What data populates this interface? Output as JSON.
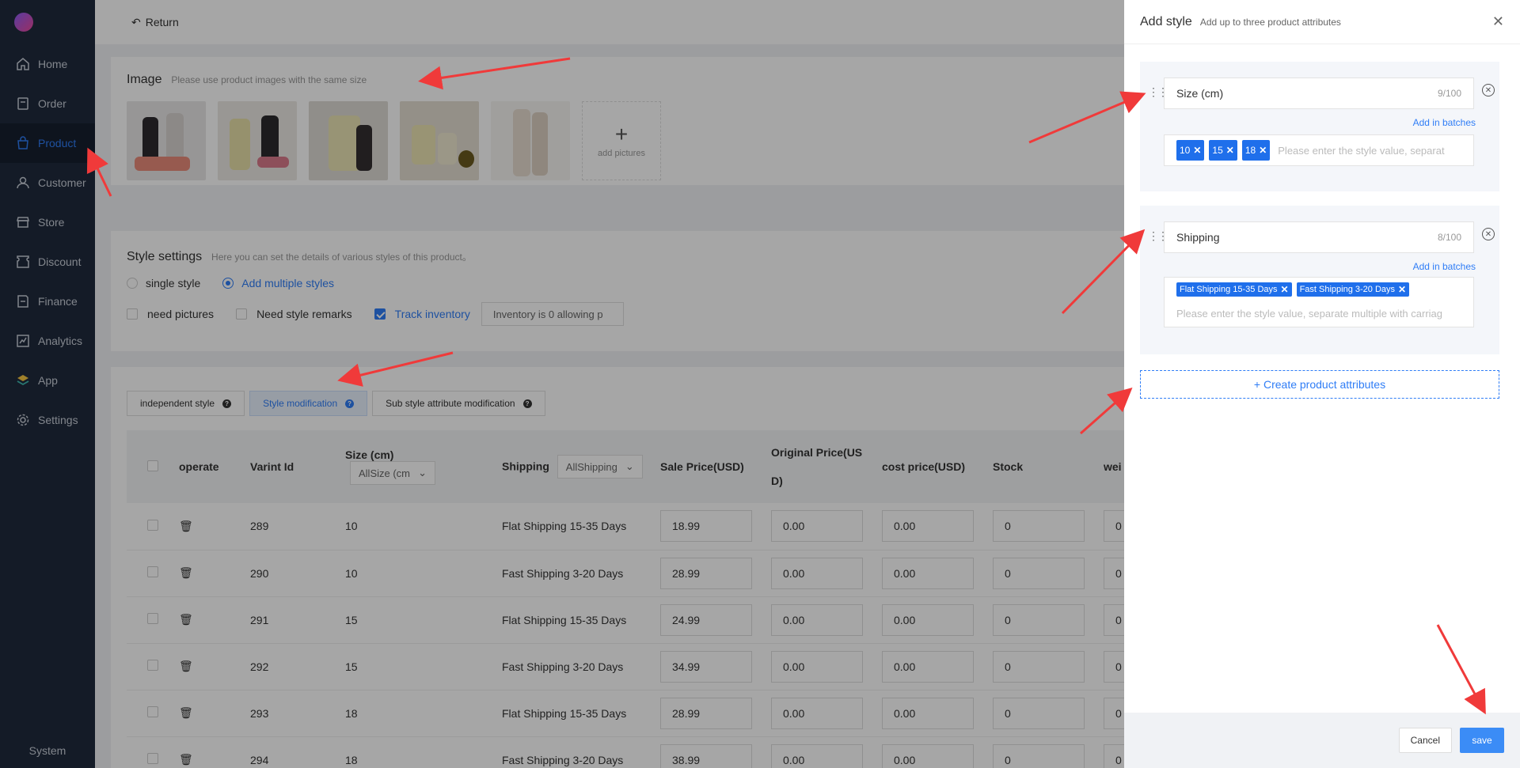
{
  "colors": {
    "accent": "#2f7df6",
    "tag": "#1f6feb",
    "sidebar": "#1f2a3d",
    "annotation": "#f03a3a"
  },
  "sidebar": {
    "items": [
      {
        "label": "Home",
        "icon": "home-icon"
      },
      {
        "label": "Order",
        "icon": "order-icon"
      },
      {
        "label": "Product",
        "icon": "bag-icon",
        "active": true
      },
      {
        "label": "Customer",
        "icon": "user-icon"
      },
      {
        "label": "Store",
        "icon": "store-icon"
      },
      {
        "label": "Discount",
        "icon": "tag-icon"
      },
      {
        "label": "Finance",
        "icon": "wallet-icon"
      },
      {
        "label": "Analytics",
        "icon": "chart-icon"
      },
      {
        "label": "App",
        "icon": "layers-icon"
      },
      {
        "label": "Settings",
        "icon": "gear-icon"
      }
    ],
    "footer": "System"
  },
  "topbar": {
    "return_label": "Return"
  },
  "image_section": {
    "title": "Image",
    "hint": "Please use product images with the same size",
    "add_label": "add pictures"
  },
  "style_settings": {
    "title": "Style settings",
    "hint": "Here you can set the details of various styles of this product。",
    "single_style": "single style",
    "multiple_styles": "Add multiple styles",
    "need_pictures": "need pictures",
    "need_remarks": "Need style remarks",
    "track_inventory": "Track inventory",
    "inventory_select": "Inventory is 0 allowing p"
  },
  "variants": {
    "tabs": [
      {
        "label": "independent style"
      },
      {
        "label": "Style modification",
        "active": true
      },
      {
        "label": "Sub style attribute modification"
      }
    ],
    "headers": {
      "operate": "operate",
      "variant_id": "Varint Id",
      "size": "Size (cm)",
      "size_filter": "AllSize (cm",
      "shipping": "Shipping",
      "shipping_filter": "AllShipping",
      "sale_price": "Sale Price(USD)",
      "original_price_a": "Original Price(US",
      "original_price_b": "D)",
      "cost_price": "cost price(USD)",
      "stock": "Stock",
      "weight": "wei"
    },
    "rows": [
      {
        "id": "289",
        "size": "10",
        "shipping": "Flat Shipping 15-35 Days",
        "sale": "18.99",
        "original": "0.00",
        "cost": "0.00",
        "stock": "0",
        "weight": "0"
      },
      {
        "id": "290",
        "size": "10",
        "shipping": "Fast Shipping 3-20 Days",
        "sale": "28.99",
        "original": "0.00",
        "cost": "0.00",
        "stock": "0",
        "weight": "0"
      },
      {
        "id": "291",
        "size": "15",
        "shipping": "Flat Shipping 15-35 Days",
        "sale": "24.99",
        "original": "0.00",
        "cost": "0.00",
        "stock": "0",
        "weight": "0"
      },
      {
        "id": "292",
        "size": "15",
        "shipping": "Fast Shipping 3-20 Days",
        "sale": "34.99",
        "original": "0.00",
        "cost": "0.00",
        "stock": "0",
        "weight": "0"
      },
      {
        "id": "293",
        "size": "18",
        "shipping": "Flat Shipping 15-35 Days",
        "sale": "28.99",
        "original": "0.00",
        "cost": "0.00",
        "stock": "0",
        "weight": "0"
      },
      {
        "id": "294",
        "size": "18",
        "shipping": "Fast Shipping 3-20 Days",
        "sale": "38.99",
        "original": "0.00",
        "cost": "0.00",
        "stock": "0",
        "weight": "0"
      }
    ]
  },
  "drawer": {
    "title": "Add style",
    "subtitle": "Add up to three product attributes",
    "attributes": [
      {
        "name": "Size (cm)",
        "count": "9/100",
        "batch_label": "Add in batches",
        "values": [
          "10",
          "15",
          "18"
        ],
        "placeholder": "Please enter the style value, separat"
      },
      {
        "name": "Shipping",
        "count": "8/100",
        "batch_label": "Add in batches",
        "values": [
          "Flat Shipping 15-35 Days",
          "Fast Shipping 3-20 Days"
        ],
        "placeholder": "Please enter the style value, separate multiple with carriag"
      }
    ],
    "create_label": "+ Create product attributes",
    "cancel_label": "Cancel",
    "save_label": "save"
  }
}
